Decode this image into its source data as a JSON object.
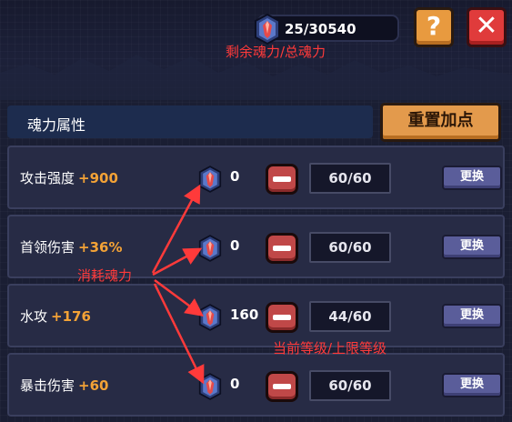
{
  "top_bar": {
    "soul_power": "25/30540",
    "annotation_soul": "剩余魂力/总魂力",
    "help_label": "?",
    "close_label": "✕"
  },
  "section": {
    "title": "魂力属性",
    "reset_label": "重置加点"
  },
  "rows": [
    {
      "name": "攻击强度",
      "bonus": "+900",
      "cost": "0",
      "level": "60/60",
      "swap_label": "更换"
    },
    {
      "name": "首领伤害",
      "bonus": "+36%",
      "cost": "0",
      "level": "60/60",
      "swap_label": "更换"
    },
    {
      "name": "水攻",
      "bonus": "+176",
      "cost": "160",
      "level": "44/60",
      "swap_label": "更换"
    },
    {
      "name": "暴击伤害",
      "bonus": "+60",
      "cost": "0",
      "level": "60/60",
      "swap_label": "更换"
    }
  ],
  "annotations": {
    "consume": "消耗魂力",
    "level": "当前等级/上限等级"
  },
  "colors": {
    "accent_orange": "#f3a236",
    "annotation_red": "#ff3a3a"
  },
  "icons": {
    "gem": "soul-gem-icon",
    "minus": "minus-icon"
  }
}
